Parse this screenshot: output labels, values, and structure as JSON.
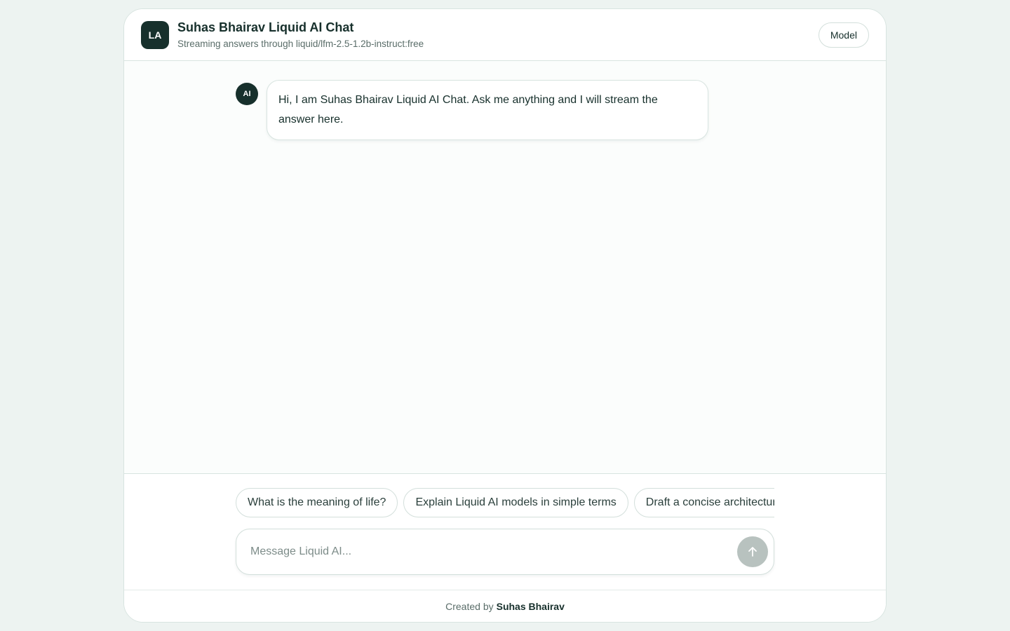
{
  "header": {
    "logo_text": "LA",
    "title": "Suhas Bhairav Liquid AI Chat",
    "subtitle": "Streaming answers through liquid/lfm-2.5-1.2b-instruct:free",
    "model_button_label": "Model"
  },
  "messages": [
    {
      "role": "assistant",
      "avatar_text": "AI",
      "text": "Hi, I am Suhas Bhairav Liquid AI Chat. Ask me anything and I will stream the answer here."
    }
  ],
  "suggestions": [
    "What is the meaning of life?",
    "Explain Liquid AI models in simple terms",
    "Draft a concise architecture"
  ],
  "composer": {
    "placeholder": "Message Liquid AI...",
    "value": "",
    "send_icon": "arrow-up-icon"
  },
  "footer": {
    "prefix": "Created by",
    "author": "Suhas Bhairav"
  },
  "colors": {
    "page_background": "#edf3f1",
    "brand_dark": "#17302c",
    "send_button_disabled": "#b8c2bf"
  }
}
